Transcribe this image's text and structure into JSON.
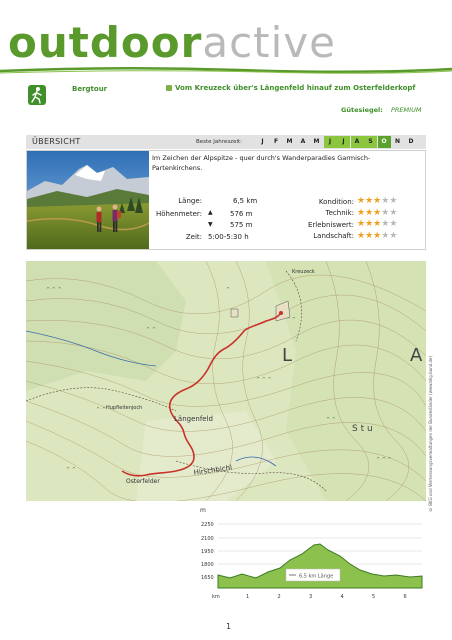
{
  "header": {
    "logo_part1": "outdoor",
    "logo_part2": "active",
    "category": "Bergtour",
    "tour_title": "Vom Kreuzeck über's Längenfeld hinauf zum Osterfelderkopf",
    "seal_label": "Gütesiegel:",
    "seal_value": "PREMIUM"
  },
  "overview": {
    "title": "ÜBERSICHT",
    "season_label": "Beste Jahreszeit:",
    "months": [
      {
        "m": "J",
        "state": "off"
      },
      {
        "m": "F",
        "state": "off"
      },
      {
        "m": "M",
        "state": "off"
      },
      {
        "m": "A",
        "state": "off"
      },
      {
        "m": "M",
        "state": "off"
      },
      {
        "m": "J",
        "state": "on"
      },
      {
        "m": "J",
        "state": "on"
      },
      {
        "m": "A",
        "state": "on"
      },
      {
        "m": "S",
        "state": "on"
      },
      {
        "m": "O",
        "state": "hi"
      },
      {
        "m": "N",
        "state": "off"
      },
      {
        "m": "D",
        "state": "off"
      }
    ],
    "description": "Im Zeichen der Alpspitze - quer durch's Wanderparadies Garmisch-Partenkirchens.",
    "length_label": "Länge:",
    "length_value": "6,5 km",
    "elevation_label": "Höhenmeter:",
    "ascent_value": "576 m",
    "descent_value": "575 m",
    "time_label": "Zeit:",
    "time_value": "5:00-5:30 h",
    "ratings": [
      {
        "label": "Kondition:",
        "stars": 3
      },
      {
        "label": "Technik:",
        "stars": 3
      },
      {
        "label": "Erlebniswert:",
        "stars": 3
      },
      {
        "label": "Landschaft:",
        "stars": 3
      }
    ],
    "max_stars": 5
  },
  "map": {
    "labels": {
      "laengenfeld": "Längenfeld",
      "hirschbichl": "Hirschbichl",
      "osterfelder": "Osterfelder",
      "hupfleiten": "Hupfleitenjoch",
      "big_l": "L",
      "big_a": "A",
      "stu": "S t u",
      "kreuzeck": "Kreuzeck"
    },
    "copyright": "© BKG und Vermessungsverwaltungen der Bundesländer (www.bkg.bund.de)"
  },
  "profile": {
    "unit": "m",
    "y_ticks": [
      "2250",
      "2100",
      "1950",
      "1800",
      "1650"
    ],
    "x_unit": "km",
    "x_ticks": [
      "1",
      "2",
      "3",
      "4",
      "5",
      "6"
    ],
    "legend": "6,5 km Länge"
  },
  "colors": {
    "brand_green": "#3f8f2a",
    "month_active": "#8cc63f",
    "month_highlight": "#5ca32c",
    "star_on": "#f0a020",
    "star_off": "#b9b9b9",
    "route": "#c8322a"
  },
  "footer": {
    "page_number": "1"
  }
}
